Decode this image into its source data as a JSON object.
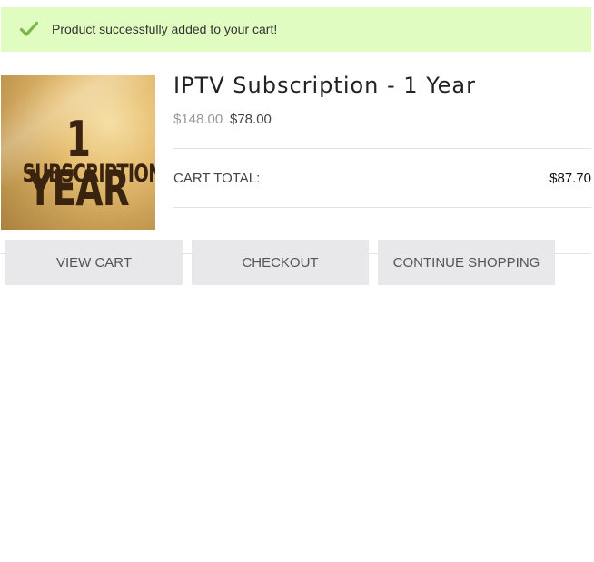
{
  "notice": {
    "message": "Product successfully added to your cart!",
    "icon": "checkmark-icon",
    "background_color": "#e1fcc1",
    "icon_color": "#7ab648"
  },
  "product": {
    "title": "IPTV Subscription - 1 Year",
    "old_price": "$148.00",
    "new_price": "$78.00",
    "image_text_line1": "1 YEAR",
    "image_text_line2": "SUBSCRIPTION"
  },
  "cart": {
    "total_label": "CART TOTAL:",
    "total_value": "$87.70"
  },
  "buttons": {
    "view_cart": "VIEW CART",
    "checkout": "CHECKOUT",
    "continue_shopping": "CONTINUE SHOPPING"
  }
}
